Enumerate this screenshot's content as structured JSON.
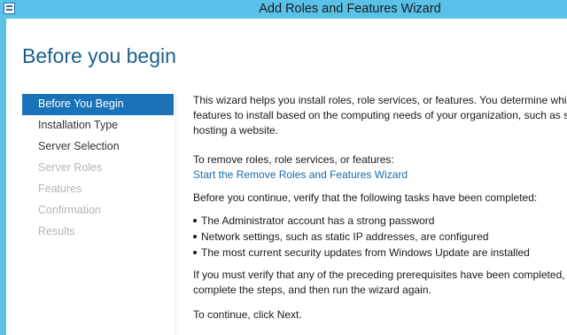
{
  "window": {
    "title": "Add Roles and Features Wizard",
    "icon": "server-manager-icon"
  },
  "page": {
    "title": "Before you begin"
  },
  "nav": {
    "items": [
      {
        "label": "Before You Begin",
        "state": "active"
      },
      {
        "label": "Installation Type",
        "state": "enabled"
      },
      {
        "label": "Server Selection",
        "state": "enabled"
      },
      {
        "label": "Server Roles",
        "state": "disabled"
      },
      {
        "label": "Features",
        "state": "disabled"
      },
      {
        "label": "Confirmation",
        "state": "disabled"
      },
      {
        "label": "Results",
        "state": "disabled"
      }
    ]
  },
  "content": {
    "intro_line1": "This wizard helps you install roles, role services, or features. You determine which",
    "intro_line2": "features to install based on the computing needs of your organization, such as s",
    "intro_line3": "hosting a website.",
    "remove_text": "To remove roles, role services, or features:",
    "remove_link": "Start the Remove Roles and Features Wizard",
    "verify_text": "Before you continue, verify that the following tasks have been completed:",
    "bullets": [
      "The Administrator account has a strong password",
      "Network settings, such as static IP addresses, are configured",
      "The most current security updates from Windows Update are installed"
    ],
    "prereq_line1": "If you must verify that any of the preceding prerequisites have been completed,",
    "prereq_line2": "complete the steps, and then run the wizard again.",
    "continue_text": "To continue, click Next."
  },
  "colors": {
    "titlebar": "#5ac2e8",
    "title_text": "#1b5f8c",
    "active_nav": "#1a73b8",
    "link": "#1a6aa8",
    "disabled_nav": "#b5b5b5"
  }
}
